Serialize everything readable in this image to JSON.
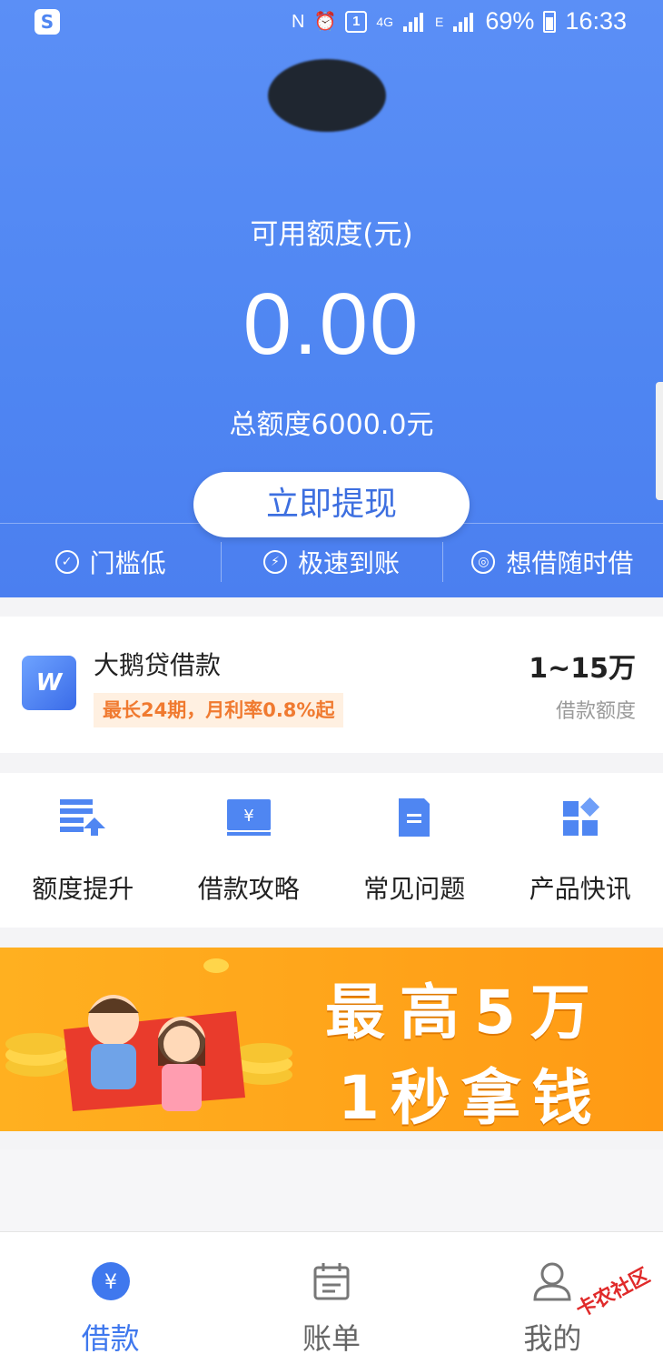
{
  "status_bar": {
    "app_badge": "S",
    "sim_badge": "1",
    "network_4g": "4G",
    "network_e": "E",
    "battery": "69%",
    "time": "16:33"
  },
  "hero": {
    "available_label": "可用额度(元)",
    "available_value": "0.00",
    "total_label": "总额度6000.0元",
    "cta_label": "立即提现",
    "features": [
      {
        "label": "门槛低",
        "icon": "check-circle-icon"
      },
      {
        "label": "极速到账",
        "icon": "lightning-circle-icon"
      },
      {
        "label": "想借随时借",
        "icon": "target-circle-icon"
      }
    ]
  },
  "product": {
    "name": "大鹅贷借款",
    "tag": "最长24期，月利率0.8%起",
    "range": "1~15万",
    "range_label": "借款额度"
  },
  "quick_menu": [
    {
      "label": "额度提升",
      "icon": "limit-up-icon"
    },
    {
      "label": "借款攻略",
      "icon": "loan-guide-icon"
    },
    {
      "label": "常见问题",
      "icon": "faq-document-icon"
    },
    {
      "label": "产品快讯",
      "icon": "product-news-icon"
    }
  ],
  "banner": {
    "line1": "最高5万",
    "line2": "1秒拿钱"
  },
  "tabbar": [
    {
      "label": "借款",
      "icon": "yuan-circle-icon",
      "active": true
    },
    {
      "label": "账单",
      "icon": "calendar-icon",
      "active": false
    },
    {
      "label": "我的",
      "icon": "user-icon",
      "active": false
    }
  ],
  "watermark": "卡农社区",
  "colors": {
    "primary": "#4f86f2",
    "accent_orange": "#f07a30",
    "banner": "#ffa41a"
  }
}
